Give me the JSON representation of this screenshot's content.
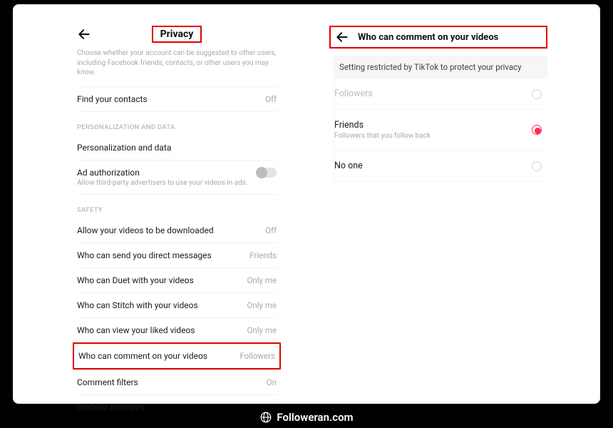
{
  "left": {
    "title": "Privacy",
    "description": "Choose whether your account can be suggested to other users, including Facebook friends, contacts, or other users you may know.",
    "find_contacts": {
      "label": "Find your contacts",
      "value": "Off"
    },
    "section_personalization": "PERSONALIZATION AND DATA",
    "personalization": {
      "label": "Personalization and data"
    },
    "ad_auth": {
      "label": "Ad authorization",
      "sub": "Allow third-party advertisers to use your videos in ads."
    },
    "section_safety": "SAFETY",
    "safety": {
      "download": {
        "label": "Allow your videos to be downloaded",
        "value": "Off"
      },
      "dm": {
        "label": "Who can send you direct messages",
        "value": "Friends"
      },
      "duet": {
        "label": "Who can Duet with your videos",
        "value": "Only me"
      },
      "stitch": {
        "label": "Who can Stitch with your videos",
        "value": "Only me"
      },
      "liked": {
        "label": "Who can view your liked videos",
        "value": "Only me"
      },
      "comment": {
        "label": "Who can comment on your videos",
        "value": "Followers"
      },
      "filters": {
        "label": "Comment filters",
        "value": "On"
      },
      "blocked": {
        "label": "Blocked accounts"
      }
    }
  },
  "right": {
    "title": "Who can comment on your videos",
    "banner": "Setting restricted by TikTok to protect your privacy",
    "options": {
      "followers": {
        "label": "Followers"
      },
      "friends": {
        "label": "Friends",
        "sub": "Followers that you follow back"
      },
      "noone": {
        "label": "No one"
      }
    }
  },
  "footer": "Followeran.com"
}
